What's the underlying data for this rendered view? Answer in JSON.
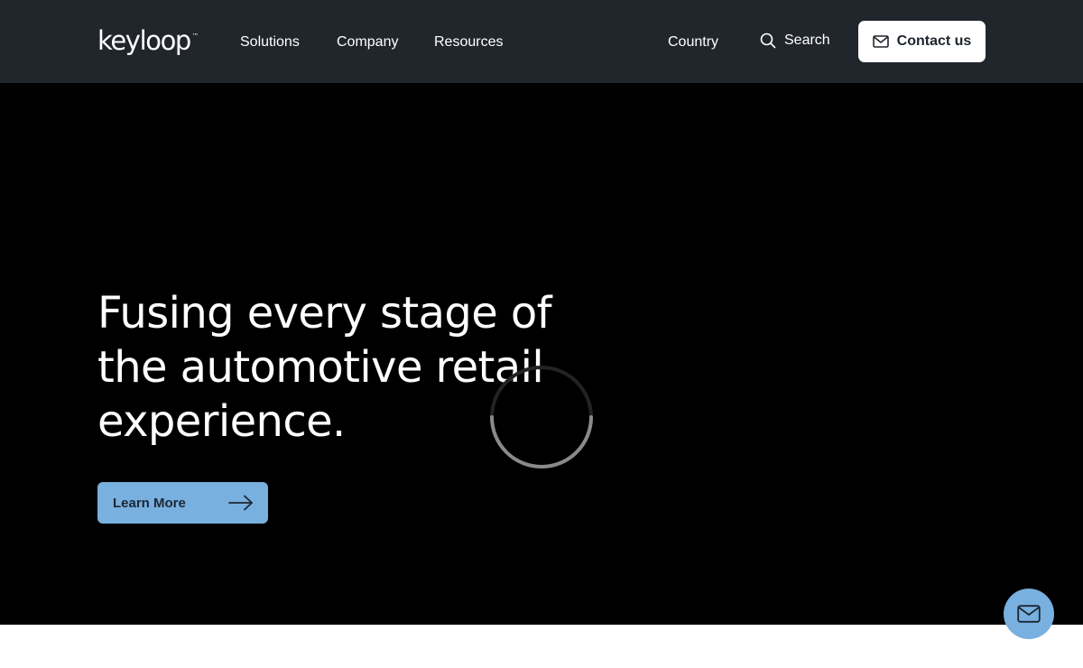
{
  "brand": {
    "name": "keyloop",
    "trademark": "™"
  },
  "nav": {
    "items": [
      {
        "label": "Solutions"
      },
      {
        "label": "Company"
      },
      {
        "label": "Resources"
      }
    ],
    "country_label": "Country",
    "search_label": "Search",
    "contact_label": "Contact us"
  },
  "hero": {
    "title_lines": [
      "Fusing every stage of",
      "the automotive retail",
      "experience."
    ],
    "cta_label": "Learn More",
    "loading": true
  },
  "icons": {
    "search": "search-icon",
    "mail": "mail-icon",
    "arrow": "arrow-right-icon",
    "spinner": "loading-spinner-icon"
  },
  "colors": {
    "header_bg": "#21262d",
    "hero_bg": "#000000",
    "accent": "#78b0df",
    "text_light": "#ffffff",
    "text_dark": "#1f252c"
  }
}
